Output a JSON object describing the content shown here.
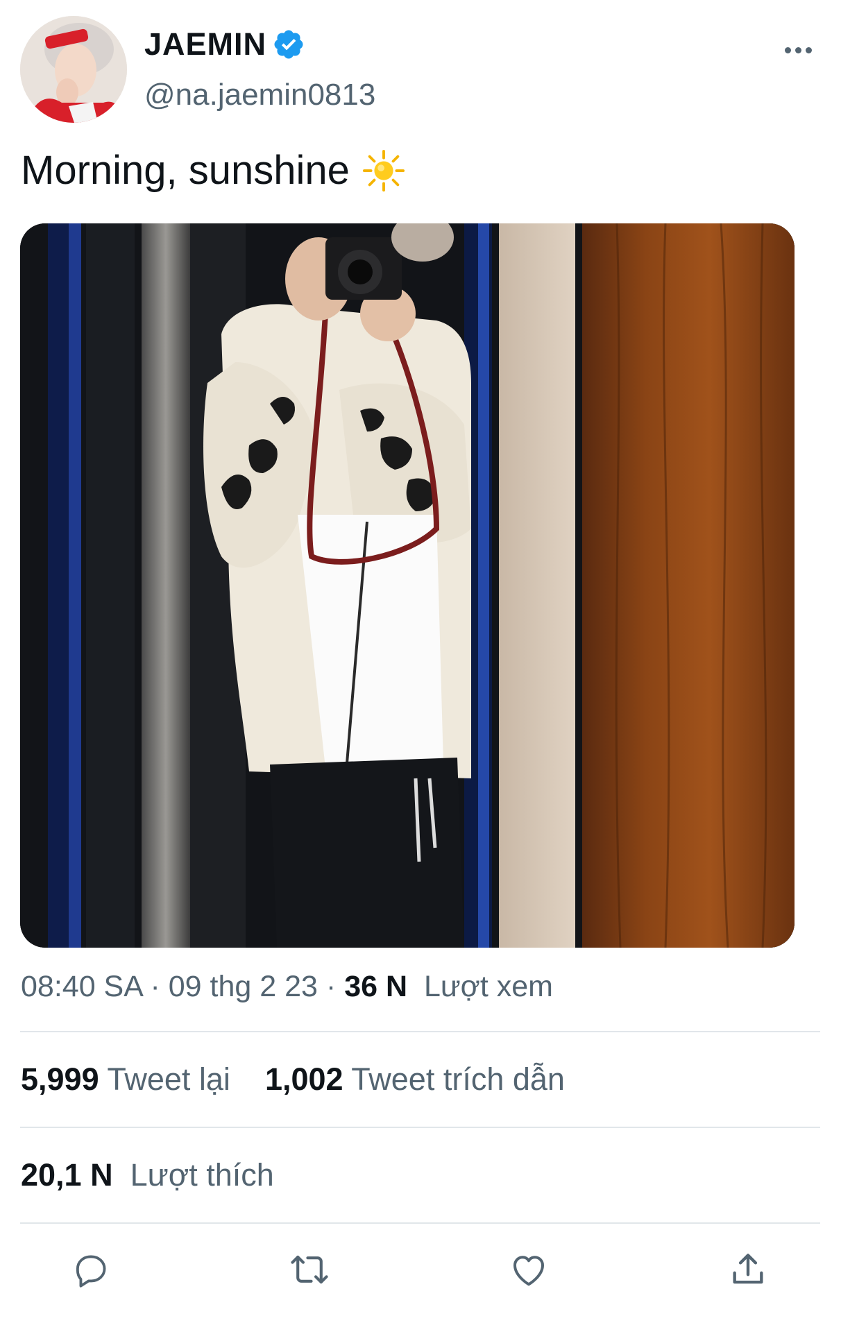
{
  "author": {
    "display_name": "JAEMIN",
    "handle": "@na.jaemin0813",
    "verified": true,
    "avatar": "profile-photo"
  },
  "tweet": {
    "text": "Morning, sunshine",
    "emoji": "sun-emoji"
  },
  "meta": {
    "time": "08:40 SA",
    "separator": " · ",
    "date": "09 thg 2 23",
    "views_count": "36 N",
    "views_label": "Lượt xem"
  },
  "stats": {
    "retweets_count": "5,999",
    "retweets_label": "Tweet lại",
    "quotes_count": "1,002",
    "quotes_label": "Tweet trích dẫn",
    "likes_count": "20,1 N",
    "likes_label": "Lượt thích"
  },
  "actions": [
    "reply-icon",
    "retweet-icon",
    "like-icon",
    "share-icon"
  ],
  "colors": {
    "verified_blue": "#1d9bf0",
    "secondary_text": "#536471",
    "primary_text": "#0f1419",
    "divider": "#e1e6ea"
  }
}
